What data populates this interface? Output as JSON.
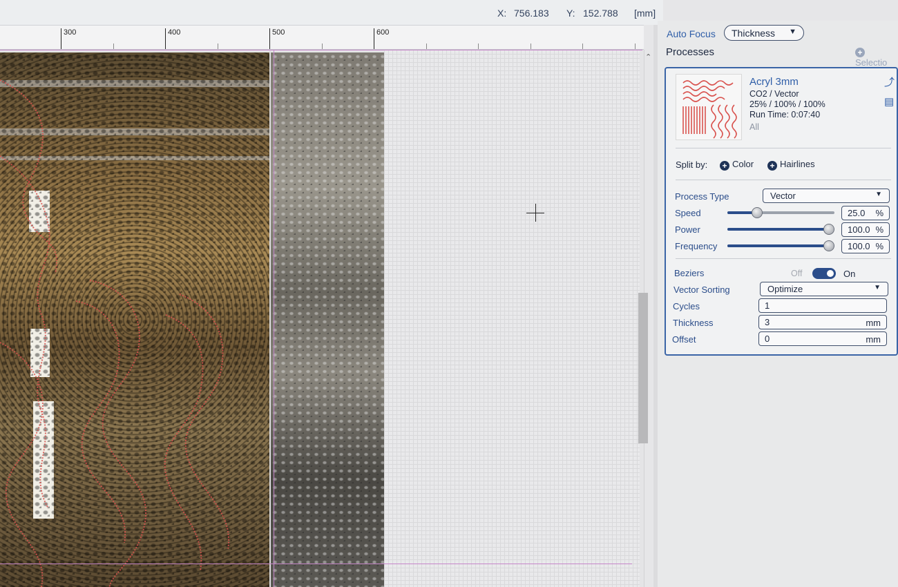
{
  "coords": {
    "x_label": "X:",
    "x_value": "756.183",
    "y_label": "Y:",
    "y_value": "152.788",
    "unit": "[mm]"
  },
  "ruler": {
    "ticks": [
      "300",
      "400",
      "500",
      "600"
    ]
  },
  "panel": {
    "auto_focus_label": "Auto Focus",
    "auto_focus_value": "Thickness",
    "processes_title": "Processes",
    "selection_link": "Selectio"
  },
  "process": {
    "name": "Acryl 3mm",
    "type": "CO2 / Vector",
    "settings": "25% / 100% / 100%",
    "run_time": "Run Time: 0:07:40",
    "scope": "All"
  },
  "split": {
    "label": "Split by:",
    "options": [
      "Color",
      "Hairlines"
    ]
  },
  "params": {
    "process_type_label": "Process Type",
    "process_type_value": "Vector",
    "speed_label": "Speed",
    "speed_value": "25.0",
    "speed_unit": "%",
    "speed_level": 0.25,
    "power_label": "Power",
    "power_value": "100.0",
    "power_unit": "%",
    "power_level": 1.0,
    "frequency_label": "Frequency",
    "frequency_value": "100.0",
    "frequency_unit": "%",
    "frequency_level": 1.0,
    "beziers_label": "Beziers",
    "beziers_off": "Off",
    "beziers_on": "On",
    "vector_sorting_label": "Vector Sorting",
    "vector_sorting_value": "Optimize",
    "cycles_label": "Cycles",
    "cycles_value": "1",
    "thickness_label": "Thickness",
    "thickness_value": "3",
    "thickness_unit": "mm",
    "offset_label": "Offset",
    "offset_value": "0",
    "offset_unit": "mm"
  },
  "colors": {
    "accent": "#2f5ea8",
    "selection_border": "#3a64a6",
    "toggle_on": "#2b4d8a",
    "cut_path": "#d9534f"
  }
}
